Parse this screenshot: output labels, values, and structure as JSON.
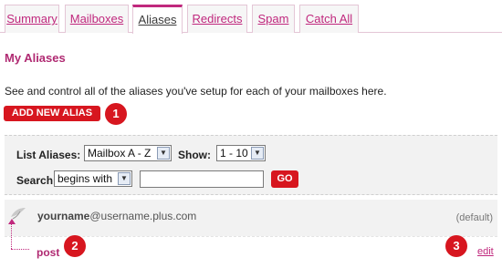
{
  "tabs": [
    {
      "label": "Summary",
      "active": false
    },
    {
      "label": "Mailboxes",
      "active": false
    },
    {
      "label": "Aliases",
      "active": true
    },
    {
      "label": "Redirects",
      "active": false
    },
    {
      "label": "Spam",
      "active": false
    },
    {
      "label": "Catch All",
      "active": false
    }
  ],
  "page": {
    "title": "My Aliases",
    "description": "See and control all of the aliases you've setup for each of your mailboxes here.",
    "add_button": "ADD NEW ALIAS"
  },
  "callouts": [
    "1",
    "2",
    "3"
  ],
  "filters": {
    "list_label": "List Aliases:",
    "list_value": "Mailbox A - Z",
    "show_label": "Show:",
    "show_value": "1 - 10",
    "search_label": "Search:",
    "search_mode": "begins with",
    "search_value": "",
    "go_label": "GO"
  },
  "mailbox": {
    "name": "yourname",
    "domain": "@username.plus.com",
    "status": "(default)"
  },
  "alias": {
    "name": "post",
    "edit_label": "edit"
  },
  "colors": {
    "accent": "#c0287d",
    "button_red": "#d7161f"
  }
}
